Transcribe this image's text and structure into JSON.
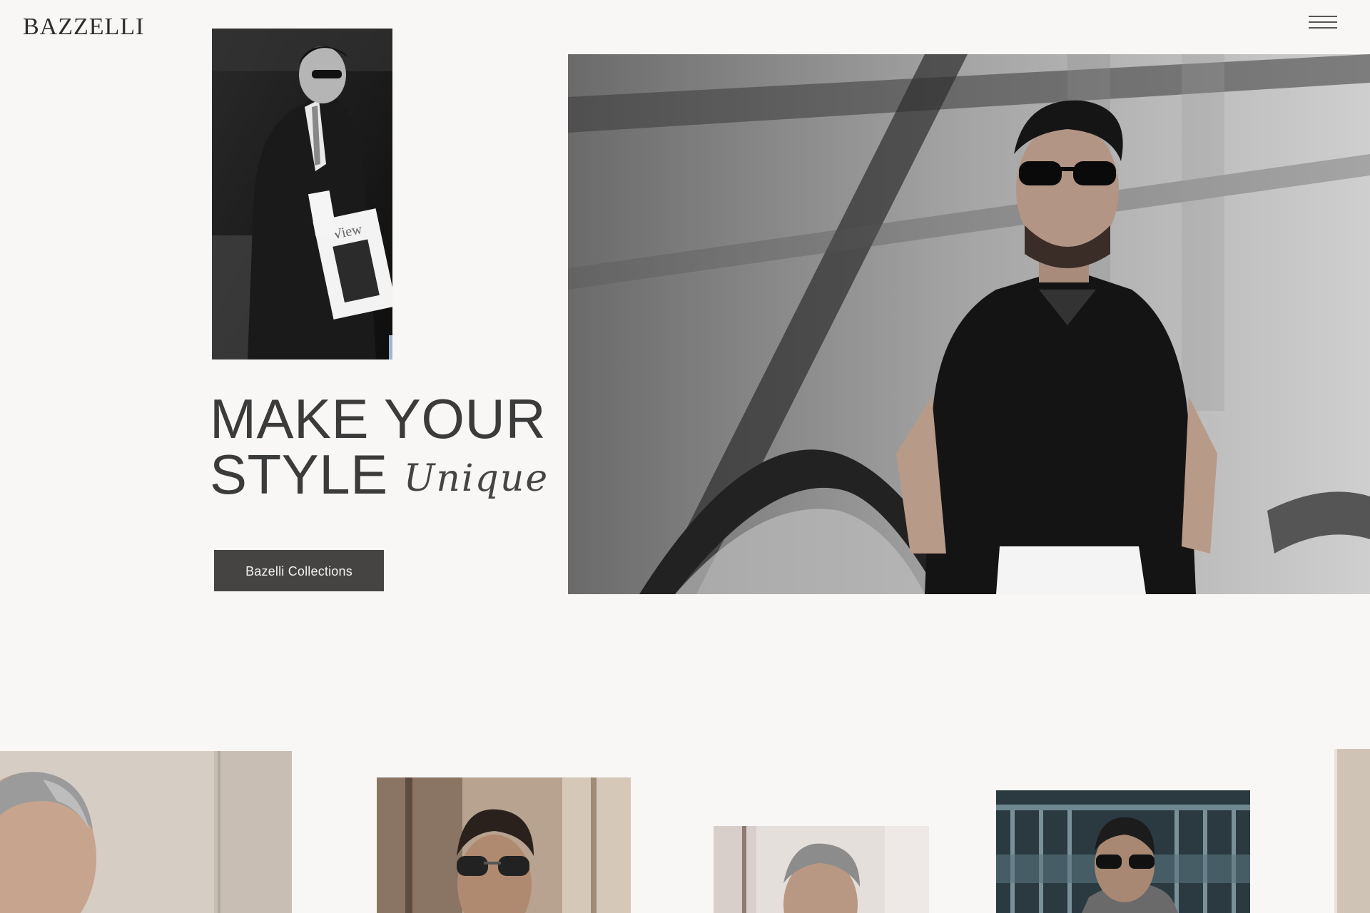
{
  "header": {
    "logo_text": "BAZZELLI",
    "menu_icon": "hamburger-menu-icon"
  },
  "hero": {
    "headline_line1": "MAKE YOUR",
    "headline_line2": "STYLE",
    "headline_script": "Unique",
    "cta_label": "Bazelli Collections"
  },
  "images": {
    "feature_small": "man in suit reading magazine",
    "feature_large": "man in black polo on escalator",
    "gallery": [
      "grey-haired man portrait",
      "man in aviator sunglasses",
      "grey-haired man in shirt",
      "man in grey coat with sunglasses",
      "partial portrait"
    ]
  },
  "colors": {
    "background": "#f8f7f5",
    "text": "#3b3b3b",
    "button": "#464443",
    "button_text": "#f2f2f2"
  }
}
